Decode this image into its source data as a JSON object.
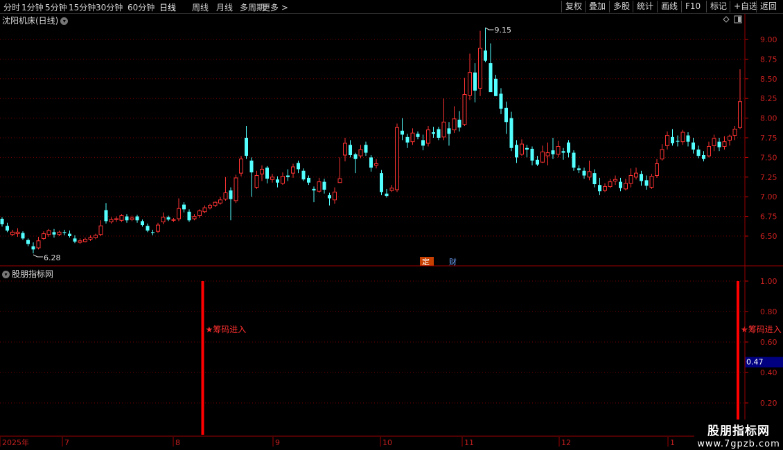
{
  "toolbar": {
    "periods": [
      "分时",
      "1分钟",
      "5分钟",
      "15分钟",
      "30分钟",
      "60分钟",
      "日线",
      "周线",
      "月线",
      "多周期",
      "更多 >"
    ],
    "active_period": "日线",
    "buttons": [
      "复权",
      "叠加",
      "多股",
      "统计",
      "画线",
      "F10",
      "标记",
      "+自选",
      "返回"
    ]
  },
  "main_chart": {
    "title": "沈阳机床(日线)",
    "high_label": "9.15",
    "low_label": "6.28",
    "markers": {
      "left": "定",
      "right": "财"
    },
    "y_ticks": [
      "9.00",
      "8.75",
      "8.50",
      "8.25",
      "8.00",
      "7.75",
      "7.50",
      "7.25",
      "7.00",
      "6.75",
      "6.50"
    ]
  },
  "indicator_panel": {
    "title": "股朋指标网",
    "signal_label": "★筹码进入",
    "y_ticks": [
      "1.00",
      "0.80",
      "0.60",
      "0.40",
      "0.20"
    ],
    "current_value": "0.47"
  },
  "date_axis": {
    "labels": [
      "2025年",
      "7",
      "8",
      "9",
      "10",
      "11",
      "12",
      "1"
    ]
  },
  "watermark": {
    "line1": "股朋指标网",
    "line2": "www.7gpzb.com"
  },
  "colors": {
    "up": "#ff3333",
    "down": "#54ffff",
    "grid": "#7a0000",
    "signal": "#ff0000",
    "value_box": "#000080"
  },
  "chart_data": {
    "type": "candlestick",
    "ylim": [
      6.2,
      9.3
    ],
    "high": 9.15,
    "low": 6.28,
    "candles": [
      [
        6.72,
        6.65,
        6.74,
        6.62
      ],
      [
        6.63,
        6.57,
        6.67,
        6.55
      ],
      [
        6.52,
        6.55,
        6.58,
        6.5
      ],
      [
        6.53,
        6.55,
        6.6,
        6.49
      ],
      [
        6.54,
        6.47,
        6.56,
        6.45
      ],
      [
        6.45,
        6.4,
        6.47,
        6.37
      ],
      [
        6.37,
        6.33,
        6.42,
        6.28
      ],
      [
        6.35,
        6.44,
        6.49,
        6.33
      ],
      [
        6.47,
        6.53,
        6.56,
        6.45
      ],
      [
        6.52,
        6.57,
        6.59,
        6.49
      ],
      [
        6.55,
        6.52,
        6.59,
        6.48
      ],
      [
        6.52,
        6.55,
        6.57,
        6.5
      ],
      [
        6.55,
        6.54,
        6.58,
        6.51
      ],
      [
        6.53,
        6.5,
        6.57,
        6.48
      ],
      [
        6.47,
        6.43,
        6.51,
        6.41
      ],
      [
        6.42,
        6.44,
        6.47,
        6.4
      ],
      [
        6.43,
        6.46,
        6.48,
        6.42
      ],
      [
        6.46,
        6.48,
        6.51,
        6.44
      ],
      [
        6.48,
        6.51,
        6.53,
        6.46
      ],
      [
        6.52,
        6.63,
        6.7,
        6.5
      ],
      [
        6.83,
        6.69,
        6.92,
        6.66
      ],
      [
        6.68,
        6.71,
        6.74,
        6.66
      ],
      [
        6.71,
        6.72,
        6.75,
        6.68
      ],
      [
        6.7,
        6.76,
        6.78,
        6.68
      ],
      [
        6.75,
        6.7,
        6.78,
        6.67
      ],
      [
        6.71,
        6.73,
        6.76,
        6.69
      ],
      [
        6.75,
        6.7,
        6.77,
        6.67
      ],
      [
        6.69,
        6.64,
        6.71,
        6.62
      ],
      [
        6.63,
        6.57,
        6.66,
        6.55
      ],
      [
        6.55,
        6.54,
        6.58,
        6.51
      ],
      [
        6.56,
        6.64,
        6.67,
        6.54
      ],
      [
        6.68,
        6.74,
        6.8,
        6.65
      ],
      [
        6.74,
        6.71,
        6.76,
        6.69
      ],
      [
        6.7,
        6.71,
        6.73,
        6.68
      ],
      [
        6.72,
        6.85,
        6.98,
        6.69
      ],
      [
        6.9,
        6.84,
        6.93,
        6.8
      ],
      [
        6.81,
        6.7,
        6.84,
        6.68
      ],
      [
        6.72,
        6.75,
        6.78,
        6.7
      ],
      [
        6.76,
        6.82,
        6.84,
        6.73
      ],
      [
        6.81,
        6.86,
        6.89,
        6.79
      ],
      [
        6.86,
        6.89,
        6.91,
        6.84
      ],
      [
        6.89,
        6.93,
        6.94,
        6.87
      ],
      [
        6.92,
        6.96,
        7.0,
        6.9
      ],
      [
        6.97,
        7.05,
        7.25,
        6.95
      ],
      [
        7.08,
        6.97,
        7.12,
        6.7
      ],
      [
        6.95,
        7.24,
        7.28,
        6.92
      ],
      [
        7.3,
        7.48,
        7.52,
        7.26
      ],
      [
        7.75,
        7.52,
        7.9,
        7.48
      ],
      [
        7.46,
        7.31,
        7.5,
        7.0
      ],
      [
        7.12,
        7.27,
        7.33,
        7.1
      ],
      [
        7.29,
        7.35,
        7.4,
        7.2
      ],
      [
        7.37,
        7.23,
        7.39,
        7.17
      ],
      [
        7.22,
        7.25,
        7.29,
        7.18
      ],
      [
        7.22,
        7.18,
        7.26,
        7.12
      ],
      [
        7.17,
        7.26,
        7.31,
        7.15
      ],
      [
        7.27,
        7.25,
        7.35,
        7.2
      ],
      [
        7.3,
        7.38,
        7.42,
        7.24
      ],
      [
        7.43,
        7.35,
        7.46,
        7.3
      ],
      [
        7.33,
        7.22,
        7.36,
        7.2
      ],
      [
        7.24,
        7.18,
        7.27,
        7.15
      ],
      [
        7.1,
        7.08,
        7.13,
        6.93
      ],
      [
        7.07,
        7.19,
        7.24,
        7.05
      ],
      [
        7.19,
        7.09,
        7.23,
        7.04
      ],
      [
        7.02,
        6.98,
        7.05,
        6.89
      ],
      [
        6.96,
        7.06,
        7.12,
        6.91
      ],
      [
        7.18,
        7.23,
        7.5,
        7.18
      ],
      [
        7.53,
        7.68,
        7.75,
        7.45
      ],
      [
        7.66,
        7.53,
        7.72,
        7.5
      ],
      [
        7.54,
        7.48,
        7.56,
        7.3
      ],
      [
        7.52,
        7.6,
        7.66,
        7.49
      ],
      [
        7.66,
        7.56,
        7.7,
        7.52
      ],
      [
        7.5,
        7.37,
        7.53,
        7.32
      ],
      [
        7.4,
        7.42,
        7.48,
        7.36
      ],
      [
        7.3,
        7.06,
        7.34,
        7.02
      ],
      [
        7.04,
        7.01,
        7.1,
        6.99
      ],
      [
        7.08,
        7.11,
        7.15,
        7.06
      ],
      [
        7.09,
        7.88,
        7.93,
        7.06
      ],
      [
        7.84,
        7.79,
        8.0,
        7.72
      ],
      [
        7.76,
        7.69,
        7.8,
        7.62
      ],
      [
        7.7,
        7.81,
        7.87,
        7.66
      ],
      [
        7.8,
        7.76,
        7.83,
        7.73
      ],
      [
        7.72,
        7.65,
        7.79,
        7.59
      ],
      [
        7.68,
        7.85,
        7.9,
        7.64
      ],
      [
        7.82,
        7.8,
        7.89,
        7.75
      ],
      [
        7.86,
        7.75,
        7.89,
        7.72
      ],
      [
        7.76,
        7.95,
        8.25,
        7.72
      ],
      [
        7.87,
        7.8,
        7.95,
        7.65
      ],
      [
        7.85,
        7.99,
        8.15,
        7.81
      ],
      [
        7.98,
        7.88,
        8.09,
        7.83
      ],
      [
        7.92,
        8.3,
        8.51,
        7.9
      ],
      [
        8.29,
        8.58,
        8.82,
        8.23
      ],
      [
        8.58,
        8.35,
        8.7,
        8.2
      ],
      [
        8.38,
        8.89,
        9.11,
        8.28
      ],
      [
        8.86,
        8.73,
        9.15,
        8.71
      ],
      [
        8.7,
        8.33,
        8.95,
        8.35
      ],
      [
        8.5,
        8.28,
        8.55,
        8.28
      ],
      [
        8.31,
        8.12,
        8.38,
        8.05
      ],
      [
        8.13,
        7.95,
        8.21,
        7.8
      ],
      [
        8.0,
        7.62,
        8.08,
        7.58
      ],
      [
        7.66,
        7.5,
        7.72,
        7.43
      ],
      [
        7.54,
        7.67,
        7.73,
        7.52
      ],
      [
        7.62,
        7.6,
        7.66,
        7.5
      ],
      [
        7.61,
        7.46,
        7.64,
        7.4
      ],
      [
        7.47,
        7.41,
        7.52,
        7.39
      ],
      [
        7.44,
        7.57,
        7.65,
        7.43
      ],
      [
        7.52,
        7.56,
        7.69,
        7.4
      ],
      [
        7.59,
        7.54,
        7.75,
        7.48
      ],
      [
        7.54,
        7.64,
        7.71,
        7.5
      ],
      [
        7.58,
        7.56,
        7.62,
        7.47
      ],
      [
        7.69,
        7.56,
        7.72,
        7.5
      ],
      [
        7.56,
        7.37,
        7.59,
        7.33
      ],
      [
        7.36,
        7.34,
        7.4,
        7.3
      ],
      [
        7.33,
        7.27,
        7.37,
        7.23
      ],
      [
        7.25,
        7.32,
        7.46,
        7.21
      ],
      [
        7.3,
        7.16,
        7.35,
        7.12
      ],
      [
        7.15,
        7.07,
        7.24,
        7.02
      ],
      [
        7.08,
        7.13,
        7.17,
        7.06
      ],
      [
        7.13,
        7.19,
        7.23,
        7.11
      ],
      [
        7.2,
        7.22,
        7.27,
        7.15
      ],
      [
        7.19,
        7.11,
        7.24,
        7.07
      ],
      [
        7.1,
        7.17,
        7.23,
        7.08
      ],
      [
        7.17,
        7.27,
        7.36,
        7.12
      ],
      [
        7.25,
        7.3,
        7.37,
        7.22
      ],
      [
        7.29,
        7.2,
        7.33,
        7.14
      ],
      [
        7.21,
        7.14,
        7.27,
        7.09
      ],
      [
        7.12,
        7.26,
        7.29,
        7.1
      ],
      [
        7.27,
        7.42,
        7.48,
        7.24
      ],
      [
        7.48,
        7.6,
        7.67,
        7.46
      ],
      [
        7.65,
        7.78,
        7.83,
        7.6
      ],
      [
        7.76,
        7.68,
        7.86,
        7.65
      ],
      [
        7.71,
        7.7,
        7.78,
        7.64
      ],
      [
        7.7,
        7.82,
        7.85,
        7.66
      ],
      [
        7.78,
        7.7,
        7.82,
        7.64
      ],
      [
        7.69,
        7.6,
        7.75,
        7.55
      ],
      [
        7.6,
        7.52,
        7.65,
        7.49
      ],
      [
        7.53,
        7.48,
        7.58,
        7.45
      ],
      [
        7.52,
        7.64,
        7.7,
        7.5
      ],
      [
        7.65,
        7.74,
        7.79,
        7.58
      ],
      [
        7.7,
        7.63,
        7.75,
        7.58
      ],
      [
        7.64,
        7.7,
        7.77,
        7.6
      ],
      [
        7.72,
        7.77,
        7.79,
        7.65
      ],
      [
        7.78,
        7.86,
        7.9,
        7.72
      ],
      [
        7.88,
        8.21,
        8.62,
        7.86
      ]
    ],
    "indicator": {
      "ylim": [
        0.05,
        1.1
      ],
      "signal_bars": [
        {
          "index": 37,
          "value": 1.0
        },
        {
          "index": 140,
          "value": 1.0
        }
      ],
      "last_value": 0.47
    }
  }
}
